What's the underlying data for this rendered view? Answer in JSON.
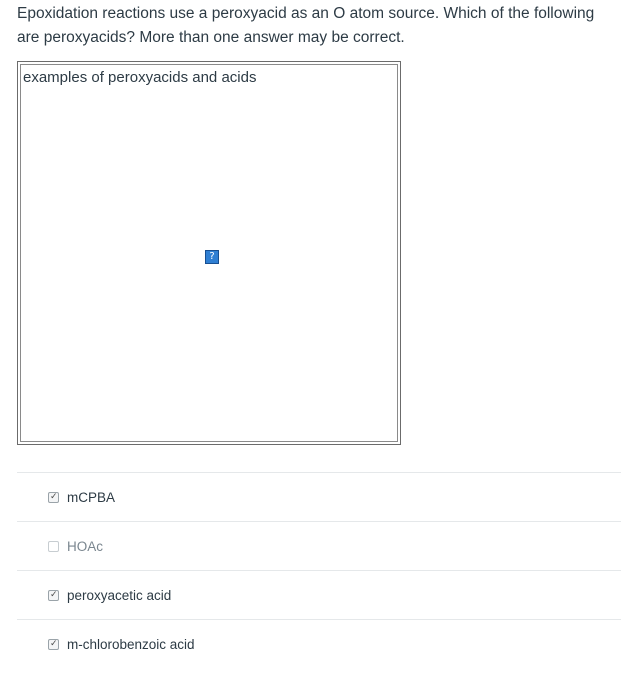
{
  "question": {
    "text": "Epoxidation reactions use a peroxyacid as an O atom source. Which of the following are peroxyacids? More than one answer may be correct."
  },
  "image": {
    "alt_text": "examples of peroxyacids and acids",
    "icon": "broken-image-question-icon"
  },
  "answers": [
    {
      "label": "mCPBA",
      "checked": true
    },
    {
      "label": "HOAc",
      "checked": false
    },
    {
      "label": "peroxyacetic acid",
      "checked": true
    },
    {
      "label": "m-chlorobenzoic acid",
      "checked": true
    }
  ],
  "colors": {
    "text": "#2d3b45",
    "muted_text": "#7a868f",
    "divider": "#e5e8ea",
    "icon_blue": "#2f7fd3"
  }
}
